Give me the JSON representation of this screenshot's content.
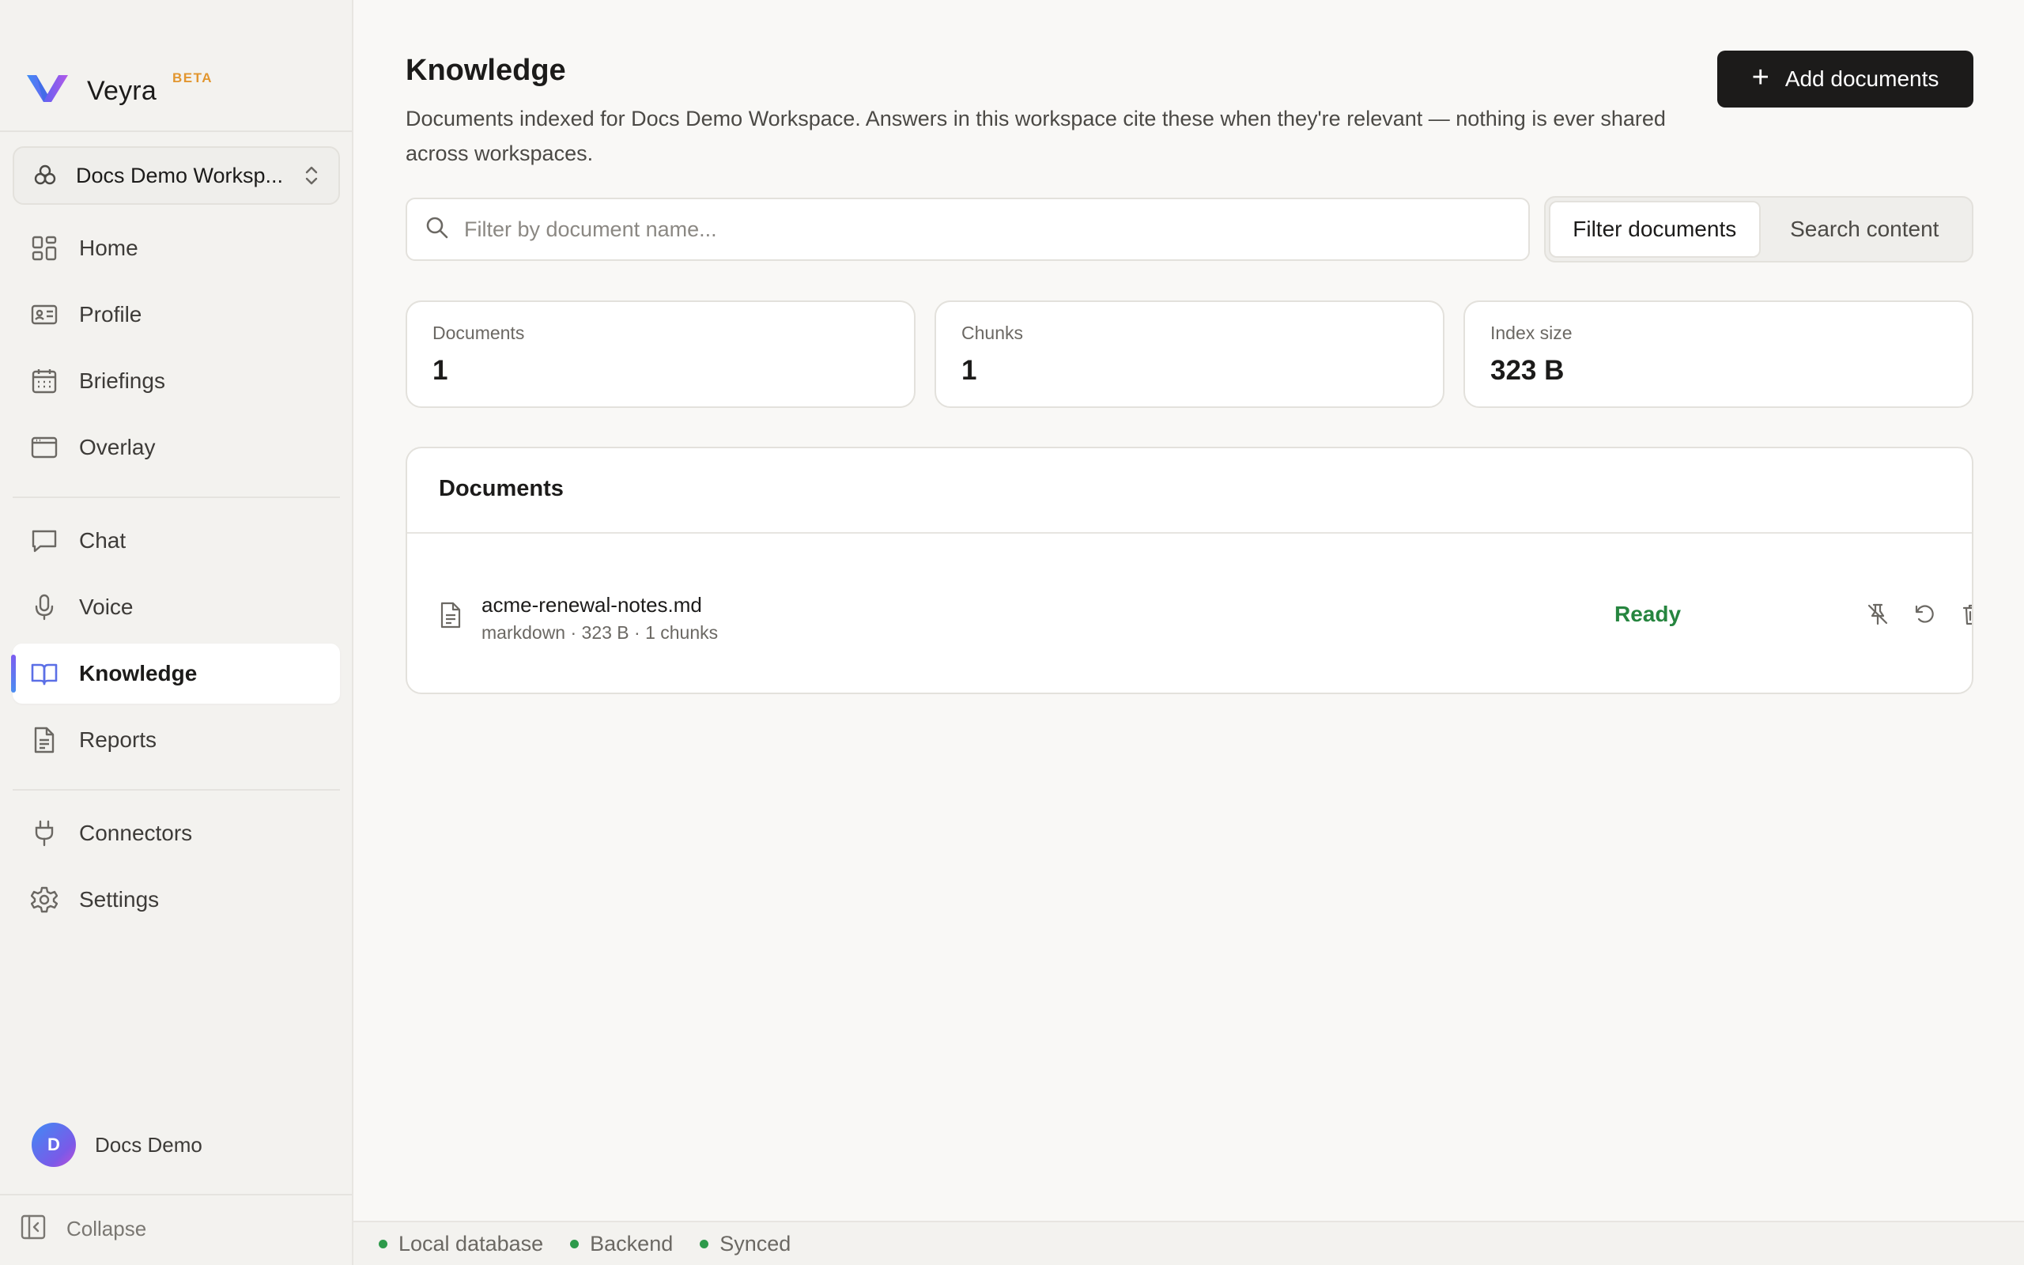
{
  "brand": {
    "name": "Veyra",
    "badge": "BETA"
  },
  "workspace": {
    "name": "Docs Demo Worksp..."
  },
  "nav": {
    "primary": [
      {
        "label": "Home",
        "icon": "grid-icon"
      },
      {
        "label": "Profile",
        "icon": "id-card-icon"
      },
      {
        "label": "Briefings",
        "icon": "calendar-icon"
      },
      {
        "label": "Overlay",
        "icon": "window-icon"
      }
    ],
    "secondary": [
      {
        "label": "Chat",
        "icon": "chat-icon"
      },
      {
        "label": "Voice",
        "icon": "microphone-icon"
      },
      {
        "label": "Knowledge",
        "icon": "book-icon",
        "active": true
      },
      {
        "label": "Reports",
        "icon": "file-text-icon"
      }
    ],
    "tertiary": [
      {
        "label": "Connectors",
        "icon": "plug-icon"
      },
      {
        "label": "Settings",
        "icon": "gear-icon"
      }
    ]
  },
  "user": {
    "initial": "D",
    "name": "Docs Demo"
  },
  "collapse_label": "Collapse",
  "page": {
    "title": "Knowledge",
    "description": "Documents indexed for Docs Demo Workspace. Answers in this workspace cite these when they're relevant — nothing is ever shared across workspaces.",
    "add_button": "Add documents"
  },
  "search": {
    "placeholder": "Filter by document name...",
    "value": ""
  },
  "mode_toggle": {
    "options": [
      "Filter documents",
      "Search content"
    ],
    "selected": "Filter documents"
  },
  "stats": [
    {
      "label": "Documents",
      "value": "1"
    },
    {
      "label": "Chunks",
      "value": "1"
    },
    {
      "label": "Index size",
      "value": "323 B"
    }
  ],
  "documents": {
    "title": "Documents",
    "rows": [
      {
        "name": "acme-renewal-notes.md",
        "meta": "markdown · 323 B · 1 chunks",
        "status": "Ready"
      }
    ]
  },
  "status_bar": [
    {
      "label": "Local database",
      "color": "#2e9a4b"
    },
    {
      "label": "Backend",
      "color": "#2e9a4b"
    },
    {
      "label": "Synced",
      "color": "#2e9a4b"
    }
  ],
  "colors": {
    "accent": "#1c1b1a",
    "ready": "#26853f",
    "badge": "#e2962f"
  }
}
